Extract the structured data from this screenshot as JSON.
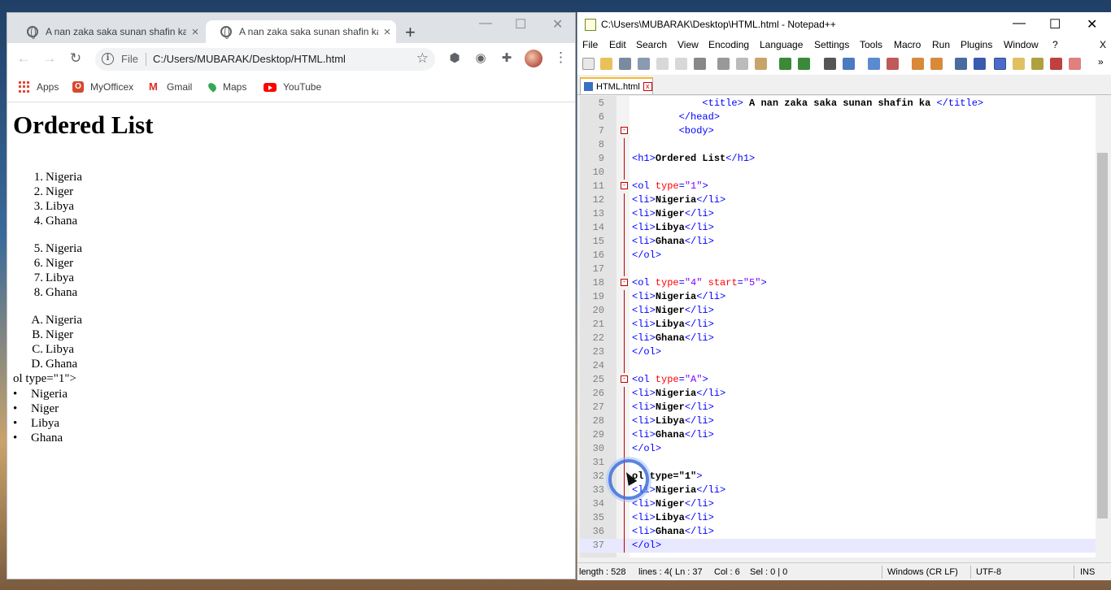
{
  "browser": {
    "tabs": [
      {
        "title": "A nan zaka saka sunan shafin ka",
        "close": "×"
      },
      {
        "title": "A nan zaka saka sunan shafin ka",
        "close": "×"
      }
    ],
    "new_tab": "+",
    "window_controls": {
      "minimize": "—",
      "maximize": "☐",
      "close": "✕"
    },
    "nav": {
      "back": "←",
      "forward": "→",
      "reload": "↻"
    },
    "address": {
      "scheme": "File",
      "url": "C:/Users/MUBARAK/Desktop/HTML.html",
      "star": "☆"
    },
    "bookmarks": [
      "Apps",
      "MyOfficex",
      "Gmail",
      "Maps",
      "YouTube"
    ],
    "page": {
      "heading": "Ordered List",
      "list1": [
        {
          "marker": "1.",
          "text": "Nigeria"
        },
        {
          "marker": "2.",
          "text": "Niger"
        },
        {
          "marker": "3.",
          "text": "Libya"
        },
        {
          "marker": "4.",
          "text": "Ghana"
        }
      ],
      "list2": [
        {
          "marker": "5.",
          "text": "Nigeria"
        },
        {
          "marker": "6.",
          "text": "Niger"
        },
        {
          "marker": "7.",
          "text": "Libya"
        },
        {
          "marker": "8.",
          "text": "Ghana"
        }
      ],
      "list3": [
        {
          "marker": "A.",
          "text": "Nigeria"
        },
        {
          "marker": "B.",
          "text": "Niger"
        },
        {
          "marker": "C.",
          "text": "Libya"
        },
        {
          "marker": "D.",
          "text": "Ghana"
        }
      ],
      "stray_text": "ol type=\"1\">",
      "bullet_list": [
        "Nigeria",
        "Niger",
        "Libya",
        "Ghana"
      ],
      "bullet_char": "•"
    }
  },
  "notepad": {
    "title": "C:\\Users\\MUBARAK\\Desktop\\HTML.html - Notepad++",
    "window_controls": {
      "minimize": "—",
      "maximize": "☐",
      "close": "✕"
    },
    "menu": [
      "File",
      "Edit",
      "Search",
      "View",
      "Encoding",
      "Language",
      "Settings",
      "Tools",
      "Macro",
      "Run",
      "Plugins",
      "Window",
      "?"
    ],
    "menu_close": "X",
    "toolbar_more": "»",
    "file_tab": {
      "name": "HTML.html",
      "close": "x"
    },
    "code_lines": [
      {
        "n": "5",
        "fold": "",
        "text": "            <title> A nan zaka saka sunan shafin ka </title>"
      },
      {
        "n": "6",
        "fold": "",
        "text": "        </head>"
      },
      {
        "n": "7",
        "fold": "-",
        "text": "        <body>"
      },
      {
        "n": "8",
        "fold": "",
        "text": ""
      },
      {
        "n": "9",
        "fold": "",
        "text": "<h1>Ordered List</h1>"
      },
      {
        "n": "10",
        "fold": "",
        "text": ""
      },
      {
        "n": "11",
        "fold": "-",
        "text": "<ol type=\"1\">"
      },
      {
        "n": "12",
        "fold": "",
        "text": "<li>Nigeria</li>"
      },
      {
        "n": "13",
        "fold": "",
        "text": "<li>Niger</li>"
      },
      {
        "n": "14",
        "fold": "",
        "text": "<li>Libya</li>"
      },
      {
        "n": "15",
        "fold": "",
        "text": "<li>Ghana</li>"
      },
      {
        "n": "16",
        "fold": "",
        "text": "</ol>"
      },
      {
        "n": "17",
        "fold": "",
        "text": ""
      },
      {
        "n": "18",
        "fold": "-",
        "text": "<ol type=\"4\" start=\"5\">"
      },
      {
        "n": "19",
        "fold": "",
        "text": "<li>Nigeria</li>"
      },
      {
        "n": "20",
        "fold": "",
        "text": "<li>Niger</li>"
      },
      {
        "n": "21",
        "fold": "",
        "text": "<li>Libya</li>"
      },
      {
        "n": "22",
        "fold": "",
        "text": "<li>Ghana</li>"
      },
      {
        "n": "23",
        "fold": "",
        "text": "</ol>"
      },
      {
        "n": "24",
        "fold": "",
        "text": ""
      },
      {
        "n": "25",
        "fold": "-",
        "text": "<ol type=\"A\">"
      },
      {
        "n": "26",
        "fold": "",
        "text": "<li>Nigeria</li>"
      },
      {
        "n": "27",
        "fold": "",
        "text": "<li>Niger</li>"
      },
      {
        "n": "28",
        "fold": "",
        "text": "<li>Libya</li>"
      },
      {
        "n": "29",
        "fold": "",
        "text": "<li>Ghana</li>"
      },
      {
        "n": "30",
        "fold": "",
        "text": "</ol>"
      },
      {
        "n": "31",
        "fold": "",
        "text": ""
      },
      {
        "n": "32",
        "fold": "",
        "text": "ol type=\"1\">"
      },
      {
        "n": "33",
        "fold": "",
        "text": "<li>Nigeria</li>"
      },
      {
        "n": "34",
        "fold": "",
        "text": "<li>Niger</li>"
      },
      {
        "n": "35",
        "fold": "",
        "text": "<li>Libya</li>"
      },
      {
        "n": "36",
        "fold": "",
        "text": "<li>Ghana</li>"
      },
      {
        "n": "37",
        "fold": "",
        "text": "</ol>"
      }
    ],
    "current_line": "37",
    "status": {
      "length": "length : 528",
      "lines": "lines : 4(",
      "ln": "Ln : 37",
      "col": "Col : 6",
      "sel": "Sel : 0 | 0",
      "eol": "Windows (CR LF)",
      "encoding": "UTF-8",
      "mode": "INS"
    }
  }
}
